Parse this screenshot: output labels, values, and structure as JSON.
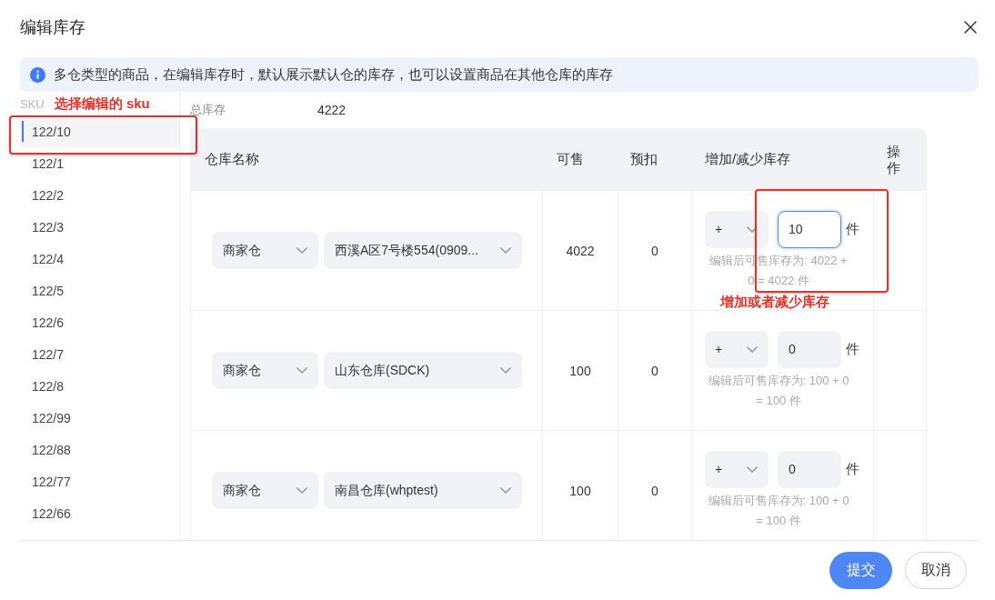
{
  "dialog": {
    "title": "编辑库存"
  },
  "notice": {
    "text": "多仓类型的商品，在编辑库存时，默认展示默认仓的库存，也可以设置商品在其他仓库的库存"
  },
  "sku_list": {
    "label": "SKU",
    "annotation": "选择编辑的 sku",
    "items": [
      {
        "label": "122/10",
        "selected": true
      },
      {
        "label": "122/1",
        "selected": false
      },
      {
        "label": "122/2",
        "selected": false
      },
      {
        "label": "122/3",
        "selected": false
      },
      {
        "label": "122/4",
        "selected": false
      },
      {
        "label": "122/5",
        "selected": false
      },
      {
        "label": "122/6",
        "selected": false
      },
      {
        "label": "122/7",
        "selected": false
      },
      {
        "label": "122/8",
        "selected": false
      },
      {
        "label": "122/99",
        "selected": false
      },
      {
        "label": "122/88",
        "selected": false
      },
      {
        "label": "122/77",
        "selected": false
      },
      {
        "label": "122/66",
        "selected": false
      }
    ]
  },
  "total_stock": {
    "label": "总库存",
    "value": "4222"
  },
  "table": {
    "columns": [
      "仓库名称",
      "可售",
      "预扣",
      "增加/减少库存",
      "操作"
    ],
    "rows": [
      {
        "warehouse_type": "商家仓",
        "warehouse": "西溪A区7号楼554(0909...",
        "available": "4022",
        "reserved": "0",
        "operator": "+",
        "quantity": "10",
        "focused": true,
        "unit": "件",
        "result": "编辑后可售库存为: 4022 + 0 = 4022 件",
        "annotation": "增加或者减少库存"
      },
      {
        "warehouse_type": "商家仓",
        "warehouse": "山东仓库(SDCK)",
        "available": "100",
        "reserved": "0",
        "operator": "+",
        "quantity": "0",
        "focused": false,
        "unit": "件",
        "result": "编辑后可售库存为: 100 + 0 = 100 件"
      },
      {
        "warehouse_type": "商家仓",
        "warehouse": "南昌仓库(whptest)",
        "available": "100",
        "reserved": "0",
        "operator": "+",
        "quantity": "0",
        "focused": false,
        "unit": "件",
        "result": "编辑后可售库存为: 100 + 0 = 100 件"
      }
    ]
  },
  "buttons": [
    {
      "label": "提交",
      "kind": "primary"
    },
    {
      "label": "取消",
      "kind": "secondary"
    }
  ]
}
